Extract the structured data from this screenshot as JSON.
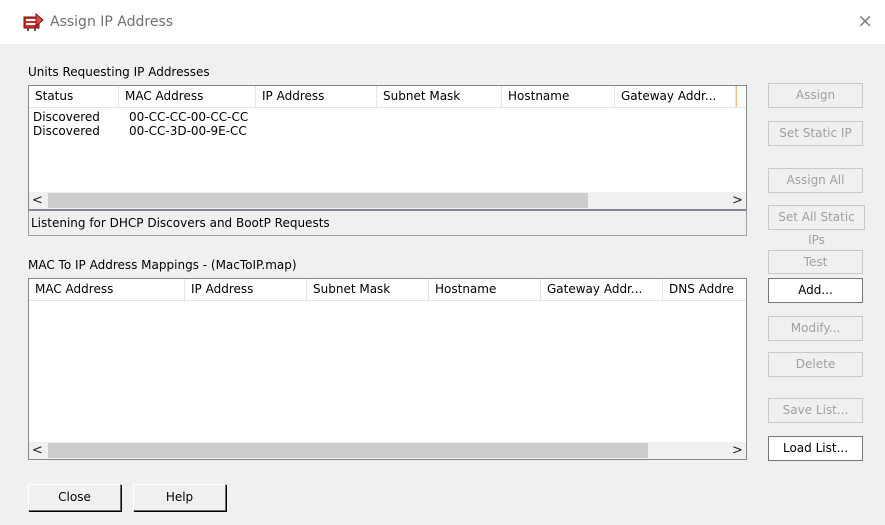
{
  "window": {
    "title": "Assign IP Address",
    "close_glyph": "×"
  },
  "units_section": {
    "label": "Units Requesting IP Addresses",
    "columns": [
      "Status",
      "MAC Address",
      "IP Address",
      "Subnet Mask",
      "Hostname",
      "Gateway Addr..."
    ],
    "rows": [
      {
        "status": "Discovered",
        "mac": "00-CC-CC-00-CC-CC"
      },
      {
        "status": "Discovered",
        "mac": "00-CC-3D-00-9E-CC"
      }
    ],
    "status_text": "Listening for DHCP Discovers and BootP Requests"
  },
  "mappings_section": {
    "label": "MAC To IP Address Mappings - (MacToIP.map)",
    "columns": [
      "MAC Address",
      "IP Address",
      "Subnet Mask",
      "Hostname",
      "Gateway Addr...",
      "DNS Addre"
    ]
  },
  "scroll": {
    "left_glyph": "<",
    "right_glyph": ">"
  },
  "buttons": {
    "assign": "Assign",
    "set_static_ip": "Set Static IP",
    "assign_all": "Assign All",
    "set_all_static_ips": "Set All Static IPs",
    "test": "Test",
    "add": "Add...",
    "modify": "Modify...",
    "delete": "Delete",
    "save_list": "Save List...",
    "load_list": "Load List...",
    "close": "Close",
    "help": "Help"
  },
  "colors": {
    "window_bg": "#f0f0f0",
    "list_bg": "#ffffff",
    "disabled_text": "#a0a0a0",
    "icon_red": "#d42a2a"
  },
  "icons": {
    "app": "network-adapter-icon",
    "close": "close-icon"
  }
}
